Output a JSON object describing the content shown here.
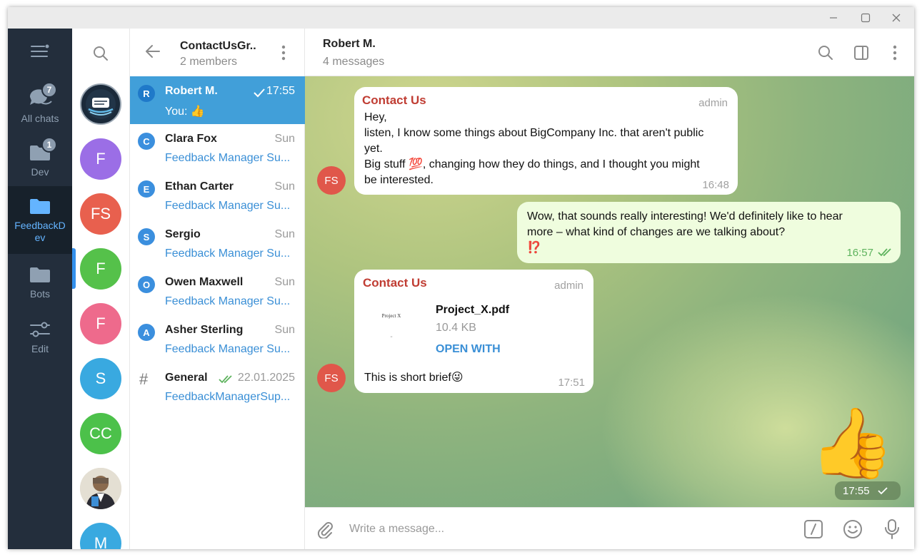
{
  "window": {
    "controls": [
      "minimize",
      "maximize",
      "close"
    ]
  },
  "folders": [
    {
      "label": "All chats",
      "icon": "chats-icon",
      "badge": "7",
      "active": false
    },
    {
      "label": "Dev",
      "icon": "folder-icon",
      "badge": "1",
      "active": false
    },
    {
      "label": "FeedbackDev",
      "label_line1": "FeedbackD",
      "label_line2": "ev",
      "icon": "folder-icon",
      "badge": "",
      "active": true
    },
    {
      "label": "Bots",
      "icon": "folder-icon",
      "badge": "",
      "active": false
    },
    {
      "label": "Edit",
      "icon": "sliders-icon",
      "badge": "",
      "active": false
    }
  ],
  "avatars": [
    {
      "text": "",
      "color": "#1b2a3a",
      "kind": "logo"
    },
    {
      "text": "F",
      "color": "#9b6ee6"
    },
    {
      "text": "FS",
      "color": "#e8604e"
    },
    {
      "text": "F",
      "color": "#55c14a"
    },
    {
      "text": "F",
      "color": "#ee6a8c"
    },
    {
      "text": "S",
      "color": "#39a9e0"
    },
    {
      "text": "CC",
      "color": "#4cc14a"
    },
    {
      "text": "",
      "color": "#c9b99e",
      "kind": "photo"
    },
    {
      "text": "M",
      "color": "#39a9e0"
    }
  ],
  "chatlist": {
    "title": "ContactUsGr..",
    "subtitle": "2 members",
    "rows": [
      {
        "initial": "R",
        "name": "Robert M.",
        "time": "17:55",
        "preview": "You: 👍",
        "active": true,
        "check": "single"
      },
      {
        "initial": "C",
        "name": "Clara Fox",
        "time": "Sun",
        "preview": "Feedback Manager Su...",
        "active": false
      },
      {
        "initial": "E",
        "name": "Ethan Carter",
        "time": "Sun",
        "preview": "Feedback Manager Su...",
        "active": false
      },
      {
        "initial": "S",
        "name": "Sergio",
        "time": "Sun",
        "preview": "Feedback Manager Su...",
        "active": false
      },
      {
        "initial": "O",
        "name": "Owen Maxwell",
        "time": "Sun",
        "preview": "Feedback Manager Su...",
        "active": false
      },
      {
        "initial": "A",
        "name": "Asher Sterling",
        "time": "Sun",
        "preview": "Feedback Manager Su...",
        "active": false
      },
      {
        "initial": "#",
        "name": "General",
        "time": "22.01.2025",
        "preview": "FeedbackManagerSup...",
        "active": false,
        "check": "double"
      }
    ]
  },
  "chat": {
    "name": "Robert M.",
    "subtitle": "4 messages",
    "messages": [
      {
        "sender": "Contact Us",
        "role": "admin",
        "lines": [
          "Hey,",
          "listen, I know some things about BigCompany Inc. that aren't public",
          "yet.",
          "Big stuff 💯, changing how they do things, and I thought you might",
          "be interested."
        ],
        "time": "16:48",
        "avatar": "FS"
      },
      {
        "lines": [
          "Wow, that sounds really interesting!  We'd definitely like to hear",
          "more – what kind of changes are we talking about?",
          "⁉️"
        ],
        "time": "16:57",
        "outgoing": true
      },
      {
        "sender": "Contact Us",
        "role": "admin",
        "file_name": "Project_X.pdf",
        "file_size": "10.4 KB",
        "file_action": "OPEN WITH",
        "thumb_text": "Project X",
        "thumb_sub": "-",
        "caption": "This is short brief😜",
        "time": "17:51",
        "avatar": "FS"
      },
      {
        "sticker": "👍",
        "time": "17:55",
        "outgoing": true
      }
    ]
  },
  "input": {
    "placeholder": "Write a message..."
  },
  "colors": {
    "accent": "#419fd9",
    "sidebar": "#232e3c",
    "sender": "#c03d33",
    "outgoing_bubble": "#effdde"
  }
}
